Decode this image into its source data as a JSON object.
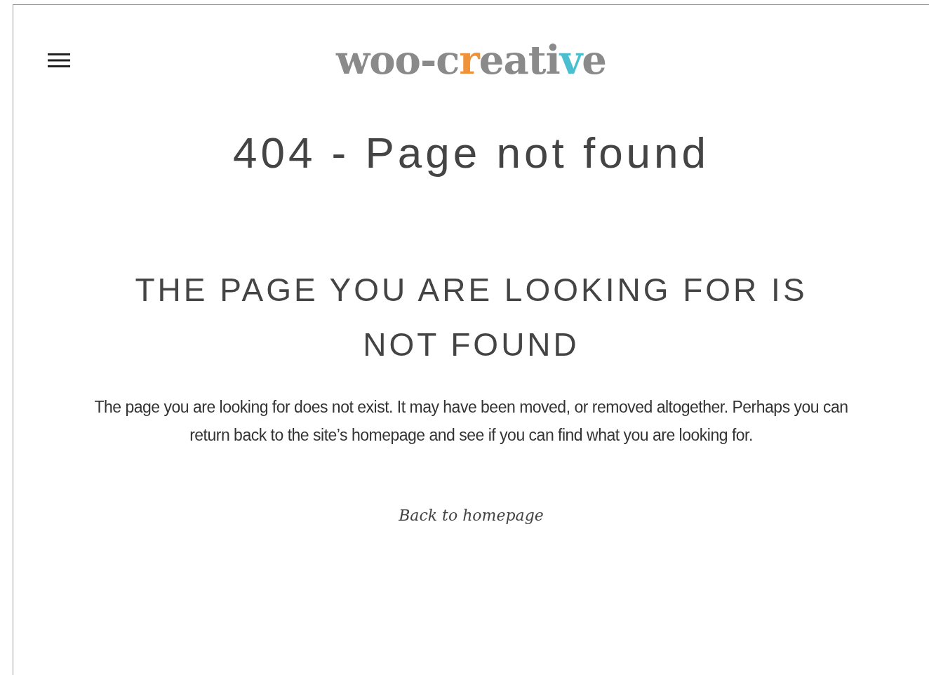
{
  "header": {
    "logo": [
      {
        "text": "woo-c",
        "color": "#8a8a8a"
      },
      {
        "text": "r",
        "color": "#f0923a"
      },
      {
        "text": "eati",
        "color": "#8a8a8a"
      },
      {
        "text": "v",
        "color": "#4bbfd0"
      },
      {
        "text": "e",
        "color": "#8a8a8a"
      }
    ]
  },
  "title": "404 - Page not found",
  "heading": "THE PAGE YOU ARE LOOKING FOR IS NOT FOUND",
  "message": "The page you are looking for does not exist. It may have been moved, or removed altogether. Perhaps you can return back to the site’s homepage and see if you can find what you are looking for.",
  "link": "Back to homepage"
}
